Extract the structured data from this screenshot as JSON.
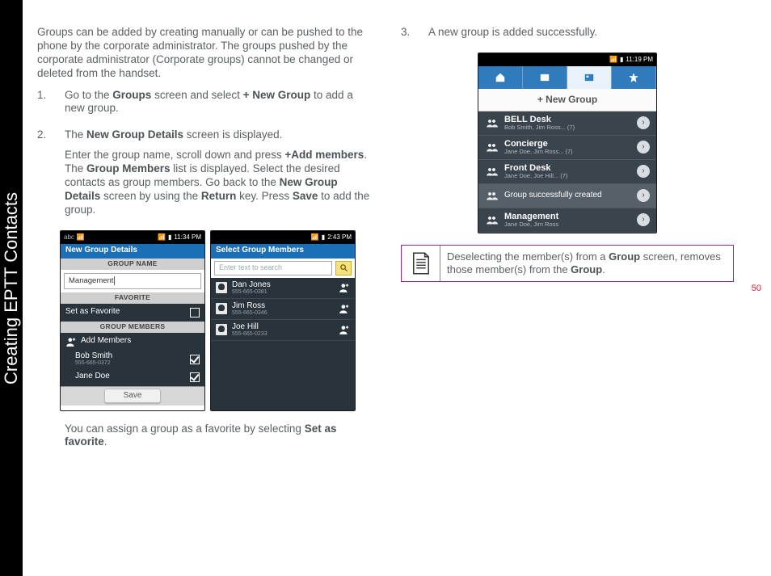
{
  "siderail_title": "Creating EPTT Contacts",
  "page_number": "50",
  "intro": "Groups can be added by creating manually or can be pushed to the phone by the corporate administrator. The groups pushed by the corporate administrator (Corporate groups) cannot be changed or deleted from the handset.",
  "step1": {
    "num": "1.",
    "pre": "Go to the ",
    "b1": "Groups",
    "mid": " screen and select ",
    "b2": "+ New Group",
    "post": " to add a new group."
  },
  "step2": {
    "num": "2.",
    "sent1_pre": "The ",
    "sent1_b": "New Group Details",
    "sent1_post": " screen is displayed.",
    "sent2_a": "Enter the group name, scroll down and press ",
    "sent2_b1": "+Add members",
    "sent2_b": ". The ",
    "sent2_b2": "Group Members",
    "sent2_c": " list is displayed. Select the desired contacts as group members. Go back to the ",
    "sent2_b3": "New Group Details",
    "sent2_d": " screen by using the ",
    "sent2_b4": "Return",
    "sent2_e": " key. Press ",
    "sent2_b5": "Save",
    "sent2_f": " to add the group."
  },
  "after_step2_pre": "You can assign a group as a favorite by selecting ",
  "after_step2_b": "Set as favorite",
  "after_step2_post": ".",
  "step3": {
    "num": "3.",
    "text": "A new group is added successfully."
  },
  "note": {
    "pre": "Deselecting the member(s) from a ",
    "b1": "Group",
    "mid": " screen, removes those member(s) from the ",
    "b2": "Group",
    "post": "."
  },
  "phone1": {
    "time": "11:34 PM",
    "status_left": "abc",
    "header": "New Group Details",
    "section_name": "GROUP NAME",
    "groupname_value": "Management",
    "section_fav": "FAVORITE",
    "fav_label": "Set as Favorite",
    "section_members": "GROUP MEMBERS",
    "add_label": "Add Members",
    "m1_name": "Bob Smith",
    "m1_num": "555-665-0372",
    "m2_name": "Jane Doe",
    "save": "Save"
  },
  "phone2": {
    "time": "2:43 PM",
    "header": "Select Group Members",
    "search_placeholder": "Enter text to search",
    "c1_name": "Dan Jones",
    "c1_num": "555-665-0381",
    "c2_name": "Jim Ross",
    "c2_num": "555-665-0346",
    "c3_name": "Joe Hill",
    "c3_num": "555-665-0233"
  },
  "phone3": {
    "time": "11:19 PM",
    "new_group": "+ New Group",
    "g1_name": "BELL Desk",
    "g1_sub": "Bob Smith, Jim Ross... (7)",
    "g2_name": "Concierge",
    "g2_sub": "Jane Doe, Jim Ross... (7)",
    "g3_name": "Front Desk",
    "g3_sub": "Jane Doe, Joe Hill... (7)",
    "toast": "Group successfully created",
    "g4_name": "Management",
    "g4_sub": "Jane Doe, Jim Ross"
  }
}
